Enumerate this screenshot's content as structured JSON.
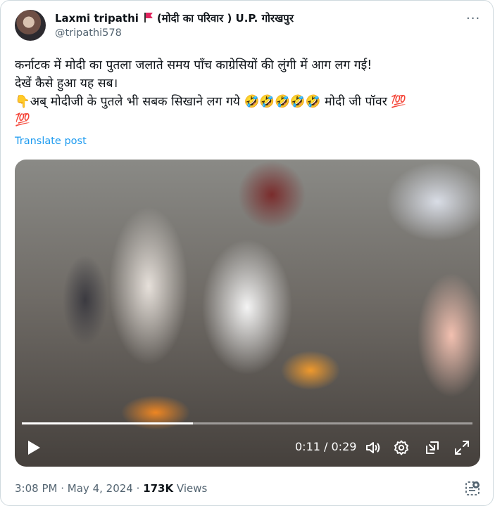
{
  "header": {
    "display_name": "Laxmi tripathi",
    "name_suffix": "(मोदी का परिवार ) U.P. गोरखपुर",
    "handle": "@tripathi578",
    "more_label": "···"
  },
  "tweet": {
    "lines": [
      "कर्नाटक में मोदी का पुतला जलाते समय पाँच काग्रेसियों की लुंगी में आग लग गई!",
      "देखें कैसे हुआ यह सब।",
      "👇अब् मोदीजी के पुतले भी सबक सिखाने लग गये 🤣🤣🤣🤣🤣 मोदी जी पॉवर 💯",
      "💯"
    ],
    "translate_label": "Translate post"
  },
  "video": {
    "current_time": "0:11",
    "duration": "0:29",
    "time_display": "0:11 / 0:29",
    "progress_fraction": 0.379
  },
  "footer": {
    "time": "3:08 PM",
    "date": "May 4, 2024",
    "views_count": "173K",
    "views_label": "Views"
  },
  "colors": {
    "accent": "#1d9bf0",
    "secondary_text": "#536471",
    "primary_text": "#0f1419",
    "flag": "#e0245e"
  },
  "icons": [
    "flag-icon",
    "more-icon",
    "play-icon",
    "volume-icon",
    "settings-icon",
    "pip-icon",
    "fullscreen-icon",
    "grok-icon"
  ]
}
